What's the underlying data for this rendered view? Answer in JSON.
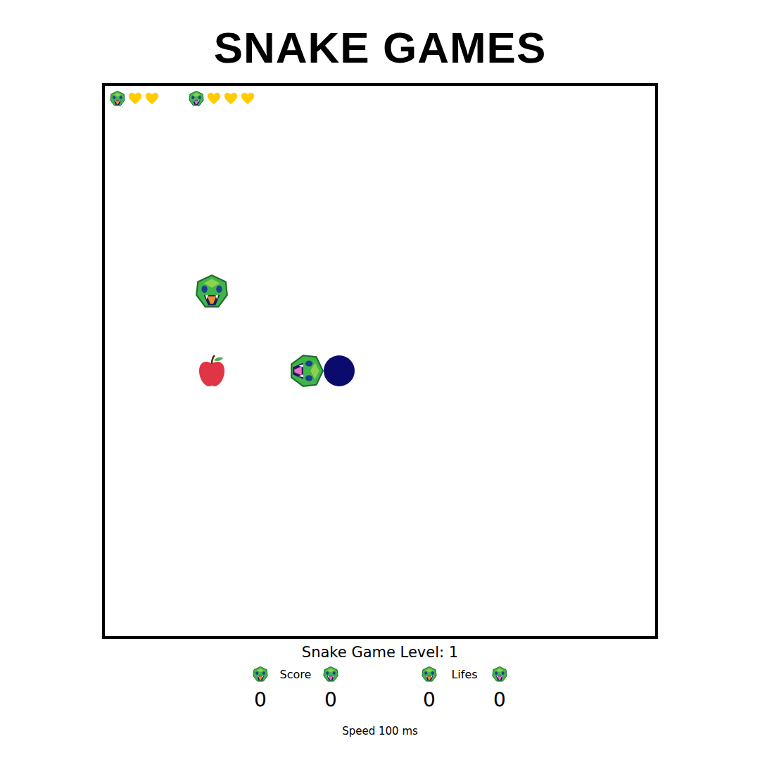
{
  "title": "SNAKE GAMES",
  "players": [
    {
      "name": "player-1",
      "hearts": 2,
      "color": "#f28c28"
    },
    {
      "name": "player-2",
      "hearts": 3,
      "color": "#f06cc4"
    }
  ],
  "board": {
    "entities": [
      {
        "kind": "snake-head",
        "player": 1,
        "facing": "down"
      },
      {
        "kind": "apple"
      },
      {
        "kind": "snake-head",
        "player": 2,
        "facing": "left"
      },
      {
        "kind": "snake-body",
        "player": 2,
        "color": "#0b0b6e"
      }
    ]
  },
  "level_label": "Snake Game Level: 1",
  "stats": [
    {
      "label": "Score",
      "values": [
        "0",
        "0"
      ]
    },
    {
      "label": "Lifes",
      "values": [
        "0",
        "0"
      ]
    }
  ],
  "speed_label": "Speed 100 ms"
}
